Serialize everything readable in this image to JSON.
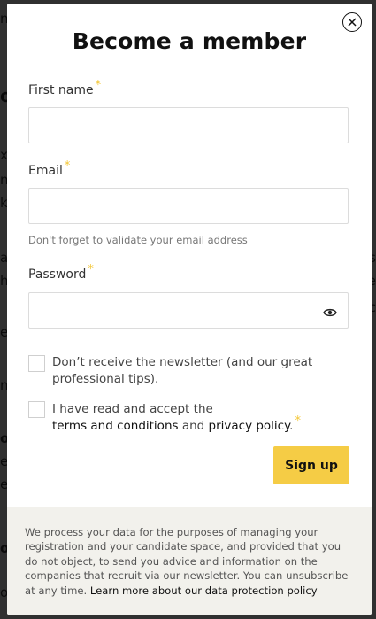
{
  "modal": {
    "title": "Become a member",
    "close_icon": "close-circle-icon"
  },
  "form": {
    "first_name": {
      "label": "First name",
      "required_mark": "*",
      "value": ""
    },
    "email": {
      "label": "Email",
      "required_mark": "*",
      "value": "",
      "hint": "Don't forget to validate your email address"
    },
    "password": {
      "label": "Password",
      "required_mark": "*",
      "value": "",
      "toggle_icon": "eye-icon"
    },
    "newsletter_opt_out": {
      "line1": "Don’t receive the newsletter (and our great",
      "line2": "professional tips).",
      "checked": false
    },
    "terms": {
      "line1": "I have read and accept the",
      "link1": "terms and conditions",
      "and": " and ",
      "link2": "privacy policy",
      "period": ".",
      "required_mark": "*",
      "checked": false
    },
    "submit_label": "Sign up"
  },
  "footer": {
    "text": "We process your data for the purposes of managing your registration and your candidate space, and provided that you do not object, to send you advice and information on the companies that recruit via our newsletter. You can unsubscribe at any time. ",
    "link": "Learn more about our data protection policy"
  },
  "colors": {
    "accent": "#f5cc45",
    "required": "#f3c634",
    "footer_bg": "#f2f1ec",
    "overlay": "#6b6b6b"
  }
}
